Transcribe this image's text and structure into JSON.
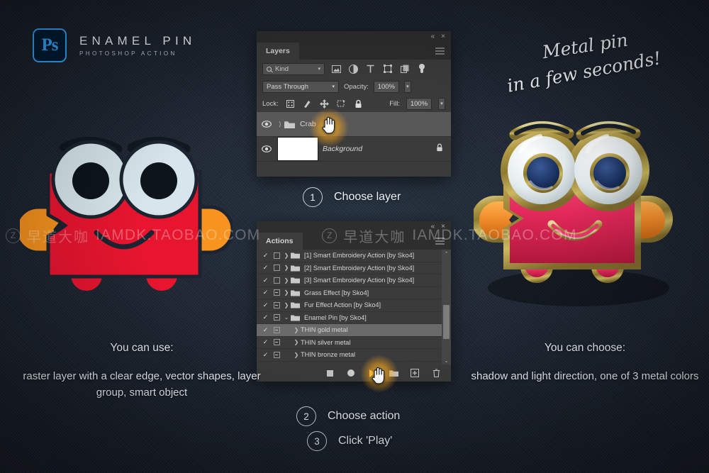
{
  "logo": {
    "badge": "Ps",
    "title": "ENAMEL PIN",
    "subtitle": "PHOTOSHOP ACTION"
  },
  "script_text": {
    "line1": "Metal pin",
    "line2": "in a few seconds!"
  },
  "captions": {
    "left": {
      "head": "You can use:",
      "body": "raster layer with a clear edge, vector shapes, layer group, smart object"
    },
    "right": {
      "head": "You can choose:",
      "body": "shadow and light direction, one of 3 metal colors"
    }
  },
  "steps": [
    {
      "num": "1",
      "label": "Choose layer"
    },
    {
      "num": "2",
      "label": "Choose action"
    },
    {
      "num": "3",
      "label": "Click 'Play'"
    }
  ],
  "layers_panel": {
    "tab": "Layers",
    "collapse": "«",
    "close": "×",
    "filter": {
      "kind": "Kind",
      "chevron": "⌄",
      "icons": [
        "image-filter-icon",
        "adjustment-filter-icon",
        "type-filter-icon",
        "shape-filter-icon",
        "smart-object-filter-icon",
        "filter-toggle-icon"
      ]
    },
    "blend": {
      "mode": "Pass Through",
      "opacity_label": "Opacity:",
      "opacity_value": "100%"
    },
    "lock": {
      "label": "Lock:",
      "fill_label": "Fill:",
      "fill_value": "100%",
      "icons": [
        "lock-transparent-icon",
        "lock-image-icon",
        "lock-position-icon",
        "lock-artboard-icon",
        "lock-all-icon"
      ]
    },
    "rows": [
      {
        "name": "Crab",
        "type": "group",
        "selected": true,
        "locked": false
      },
      {
        "name": "Background",
        "type": "background",
        "selected": false,
        "locked": true
      }
    ]
  },
  "actions_panel": {
    "tab": "Actions",
    "collapse": "«",
    "close": "×",
    "rows": [
      {
        "name": "[1] Smart Embroidery Action [by Sko4]",
        "checked": true,
        "modal": "empty",
        "indent": 0,
        "folder": true,
        "selected": false
      },
      {
        "name": "[2] Smart Embroidery Action [by Sko4]",
        "checked": true,
        "modal": "empty",
        "indent": 0,
        "folder": true,
        "selected": false
      },
      {
        "name": "[3] Smart Embroidery Action [by Sko4]",
        "checked": true,
        "modal": "empty",
        "indent": 0,
        "folder": true,
        "selected": false
      },
      {
        "name": "Grass Effect [by Sko4]",
        "checked": true,
        "modal": "dash",
        "indent": 0,
        "folder": true,
        "selected": false
      },
      {
        "name": "Fur Effect Action [by Sko4]",
        "checked": true,
        "modal": "dash",
        "indent": 0,
        "folder": true,
        "selected": false
      },
      {
        "name": "Enamel Pin [by Sko4]",
        "checked": true,
        "modal": "dash",
        "indent": 0,
        "folder": true,
        "selected": false,
        "expanded": true
      },
      {
        "name": "THIN gold metal",
        "checked": true,
        "modal": "dash",
        "indent": 1,
        "folder": false,
        "selected": true
      },
      {
        "name": "THIN silver metal",
        "checked": true,
        "modal": "dash",
        "indent": 1,
        "folder": false,
        "selected": false
      },
      {
        "name": "THIN bronze metal",
        "checked": true,
        "modal": "dash",
        "indent": 1,
        "folder": false,
        "selected": false
      }
    ],
    "toolbar": [
      "stop-button",
      "record-button",
      "play-button",
      "new-set-button",
      "new-action-button",
      "delete-button"
    ],
    "scroll": {
      "up": "⌃",
      "down": "⌄"
    }
  },
  "watermark": {
    "badge": "Z",
    "chinese": "早道大咖",
    "english": "IAMDK.TAOBAO.COM"
  },
  "colors": {
    "accent_blue": "#31a8ff",
    "crab_red": "#e8152f",
    "crab_orange": "#f7931e",
    "eye_white": "#d7e6ec",
    "pin_gold": "#b9a24a",
    "pin_enamel": "#e8285a",
    "panel_bg": "#3b3b3b",
    "denim": "#1c2431"
  },
  "artwork": {
    "flat_label": "flat-crab-illustration",
    "pin_label": "enamel-pin-crab-illustration"
  }
}
